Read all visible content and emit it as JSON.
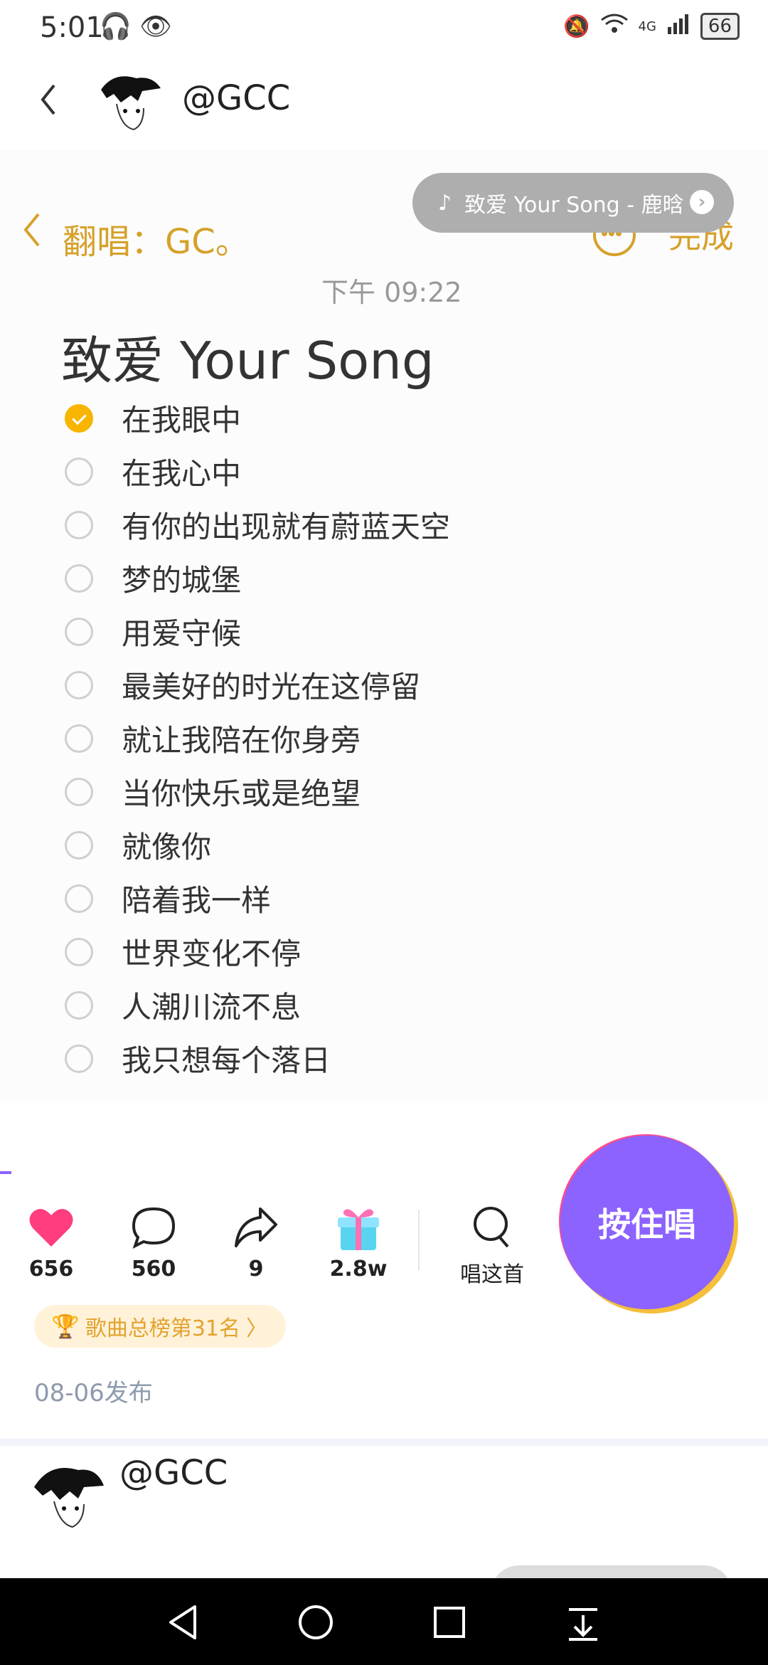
{
  "status_bar": {
    "time": "5:01",
    "left_icons": "🎧 👁",
    "network": "4G",
    "battery": "66"
  },
  "header": {
    "username": "@GCC"
  },
  "note": {
    "header_title": "翻唱：GC。",
    "done_label": "完成",
    "time": "下午 09:22",
    "title": "致爱 Your Song",
    "lyrics": [
      {
        "text": "在我眼中",
        "checked": true
      },
      {
        "text": "在我心中",
        "checked": false
      },
      {
        "text": "有你的出现就有蔚蓝天空",
        "checked": false
      },
      {
        "text": "梦的城堡",
        "checked": false
      },
      {
        "text": "用爱守候",
        "checked": false
      },
      {
        "text": "最美好的时光在这停留",
        "checked": false
      },
      {
        "text": "就让我陪在你身旁",
        "checked": false
      },
      {
        "text": "当你快乐或是绝望",
        "checked": false
      },
      {
        "text": "就像你",
        "checked": false
      },
      {
        "text": "陪着我一样",
        "checked": false
      },
      {
        "text": "世界变化不停",
        "checked": false
      },
      {
        "text": "人潮川流不息",
        "checked": false
      },
      {
        "text": "我只想每个落日",
        "checked": false
      }
    ]
  },
  "music_pill": {
    "note_icon": "♪",
    "text": "致爱 Your Song - 鹿晗",
    "arrow_icon": "›"
  },
  "actions": {
    "likes": "656",
    "comments": "560",
    "shares": "9",
    "gifts": "2.8w",
    "sing_this": "唱这首",
    "hold_to_sing": "按住唱"
  },
  "rank_badge": {
    "icon": "🏆",
    "text": "歌曲总榜第31名",
    "chevron": "〉"
  },
  "publish_date": "08-06发布",
  "next_post": {
    "username": "@GCC"
  },
  "colors": {
    "accent_gold": "#d6a12a",
    "checkbox_on": "#f7b500",
    "sing_button": "#8c63ff",
    "like_heart": "#ff3d7f"
  },
  "icons": [
    "back-icon",
    "music-note-icon",
    "chevron-right-icon",
    "more-icon",
    "heart-icon",
    "comment-icon",
    "share-icon",
    "gift-icon",
    "mic-bubble-icon",
    "trophy-icon",
    "nav-back-icon",
    "nav-home-icon",
    "nav-recents-icon",
    "nav-down-icon"
  ]
}
